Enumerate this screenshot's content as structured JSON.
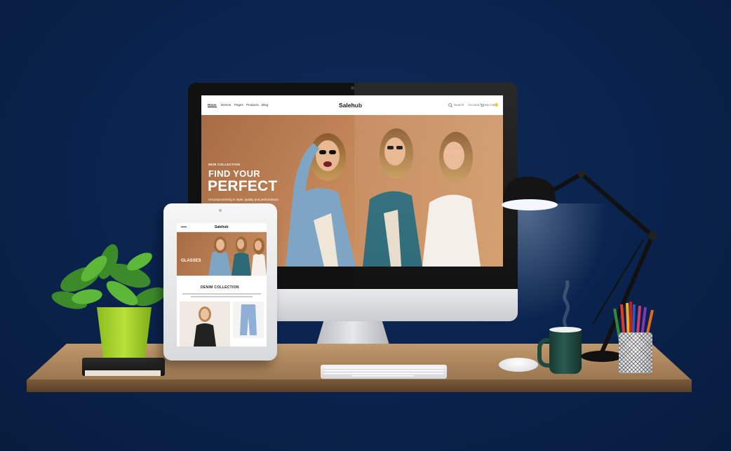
{
  "site": {
    "logo": "Salehub",
    "nav": [
      "Home",
      "Demos",
      "Pages",
      "Products",
      "Blog"
    ],
    "nav_right": {
      "search": "Search",
      "account": "Account",
      "cart": "My Cart"
    },
    "hero": {
      "kicker": "NEW COLLECTION",
      "line1": "FIND YOUR",
      "line2": "PERFECT",
      "subtitle": "Uncompromising in style, quality and performance"
    }
  },
  "tablet": {
    "logo": "Salehub",
    "hero_text": "GLASSES",
    "section_title": "DENIM COLLECTION"
  },
  "colors": {
    "background": "#0a234c",
    "hero_tan": "#c4875a",
    "desk_wood": "#b08a60",
    "pot_green": "#a6d42d",
    "mug_green": "#1f4a40"
  }
}
